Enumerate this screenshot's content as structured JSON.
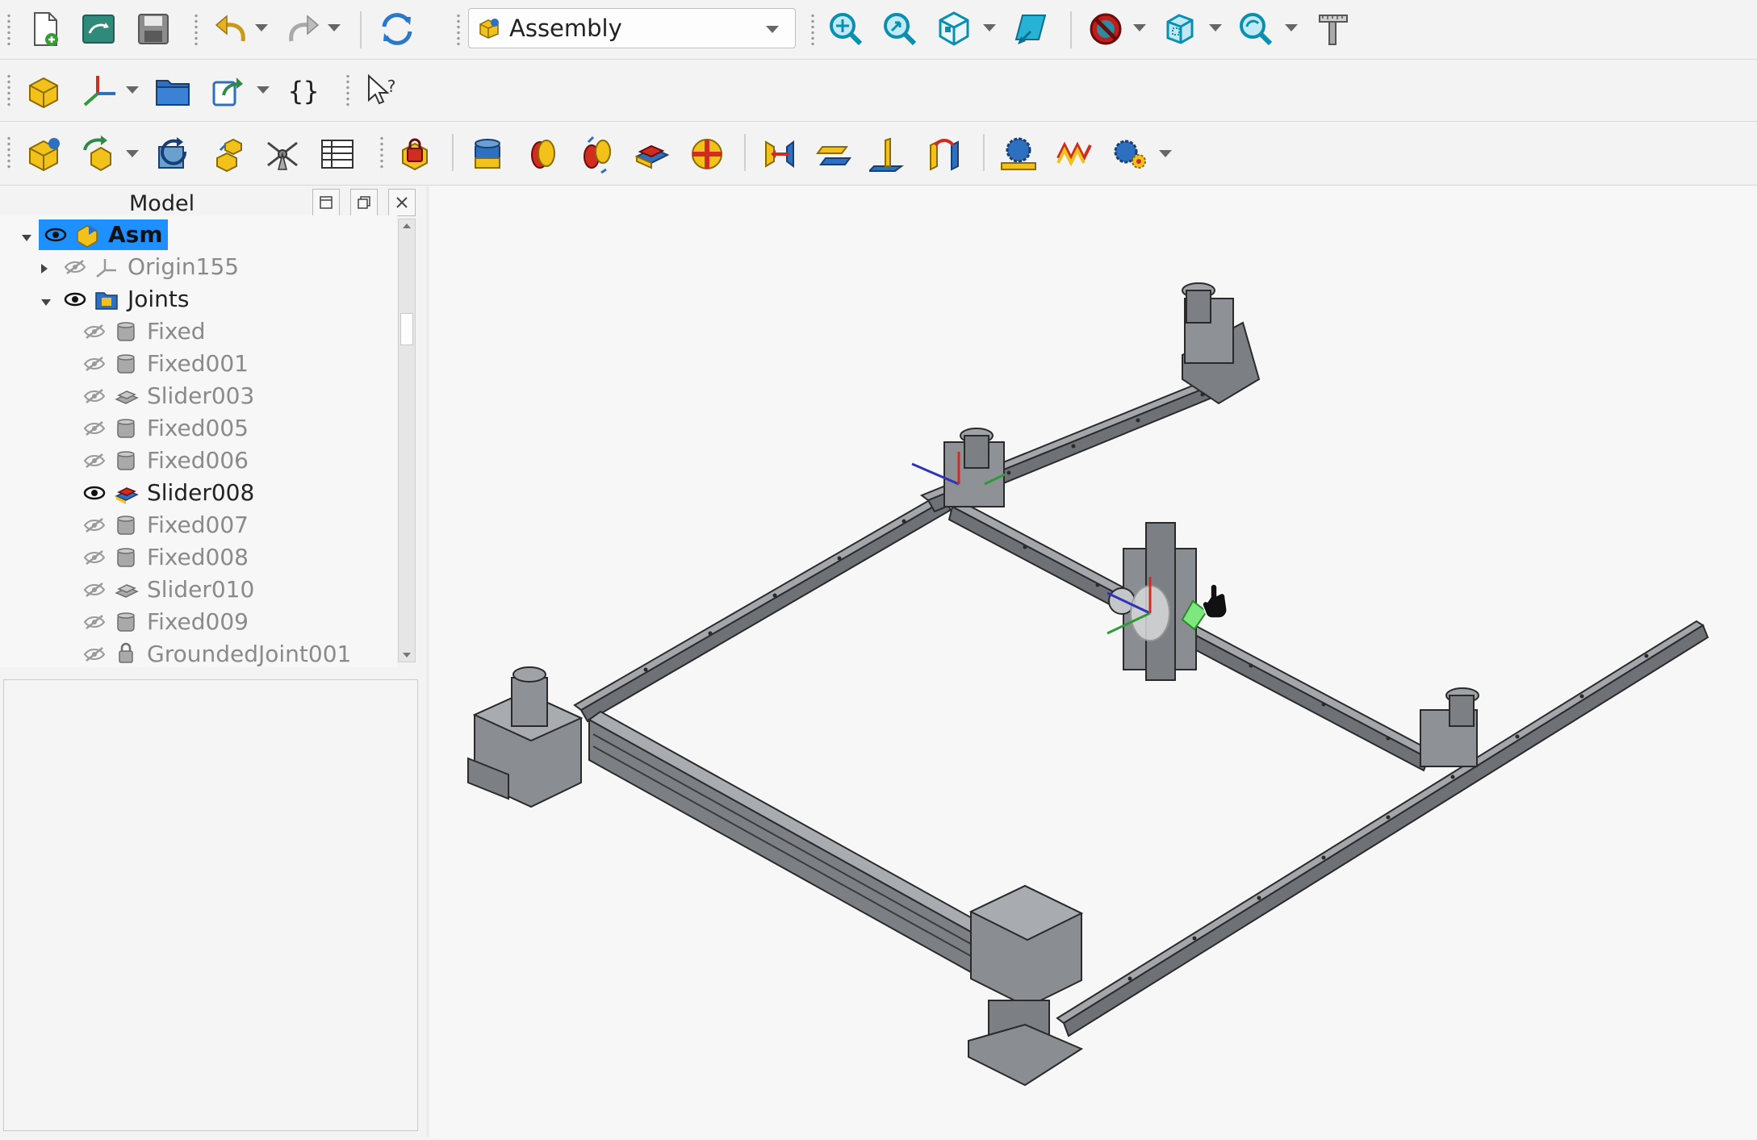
{
  "toolbar": {
    "file_new": "new-file-icon",
    "file_open": "open-file-icon",
    "file_save": "save-icon",
    "undo": "undo-icon",
    "redo": "redo-icon",
    "refresh": "refresh-icon",
    "workbench_value": "Assembly",
    "view_fit_all": "fit-all-icon",
    "view_fit_selection": "fit-selection-icon",
    "view_isometric": "isometric-view-icon",
    "view_sketch": "view-sketch-icon",
    "draw_style": "draw-style-icon",
    "bounding_box": "bounding-box-icon",
    "zoom": "zoom-icon",
    "measure": "measure-icon",
    "create_part": "create-part-icon",
    "coordinate_system": "coordinate-system-icon",
    "group": "group-folder-icon",
    "link_make": "make-link-icon",
    "variable_set": "variable-set-icon",
    "whats_this": "whats-this-icon",
    "new_assembly": "new-assembly-icon",
    "insert_component": "insert-component-icon",
    "solve": "solve-assembly-icon",
    "explode": "exploded-view-icon",
    "simulation": "simulation-icon",
    "bom": "bill-of-materials-icon",
    "ground": "ground-joint-icon",
    "joint_fixed": "fixed-joint-icon",
    "joint_revolute": "revolute-joint-icon",
    "joint_cylindrical": "cylindrical-joint-icon",
    "joint_slider": "slider-joint-icon",
    "joint_ball": "ball-joint-icon",
    "joint_distance": "distance-joint-icon",
    "joint_parallel": "parallel-joint-icon",
    "joint_perpendicular": "perpendicular-joint-icon",
    "joint_angle": "angle-joint-icon",
    "joint_rack_pinion": "rack-pinion-icon",
    "joint_screw": "screw-joint-icon",
    "joint_gears": "gears-joint-icon"
  },
  "panel": {
    "title": "Model"
  },
  "tree": [
    {
      "label": "Asm",
      "visible": true,
      "selected": true,
      "expanded": true,
      "icon": "assembly-icon"
    },
    {
      "label": "Origin155",
      "visible": false,
      "expanded": false,
      "icon": "origin-icon"
    },
    {
      "label": "Joints",
      "visible": true,
      "expanded": true,
      "icon": "joint-group-icon"
    },
    {
      "label": "Fixed",
      "visible": false,
      "icon": "fixed-joint-icon"
    },
    {
      "label": "Fixed001",
      "visible": false,
      "icon": "fixed-joint-icon"
    },
    {
      "label": "Slider003",
      "visible": false,
      "icon": "slider-joint-icon"
    },
    {
      "label": "Fixed005",
      "visible": false,
      "icon": "fixed-joint-icon"
    },
    {
      "label": "Fixed006",
      "visible": false,
      "icon": "fixed-joint-icon"
    },
    {
      "label": "Slider008",
      "visible": true,
      "icon": "slider-joint-icon"
    },
    {
      "label": "Fixed007",
      "visible": false,
      "icon": "fixed-joint-icon"
    },
    {
      "label": "Fixed008",
      "visible": false,
      "icon": "fixed-joint-icon"
    },
    {
      "label": "Slider010",
      "visible": false,
      "icon": "slider-joint-icon"
    },
    {
      "label": "Fixed009",
      "visible": false,
      "icon": "fixed-joint-icon"
    },
    {
      "label": "GroundedJoint001",
      "visible": false,
      "icon": "grounded-joint-icon"
    }
  ],
  "colors": {
    "selection": "#1e90ff",
    "accent_yellow": "#f2c21b",
    "accent_blue": "#2f6fbf",
    "accent_red": "#d12c1f",
    "model_gray": "#7d8185"
  }
}
